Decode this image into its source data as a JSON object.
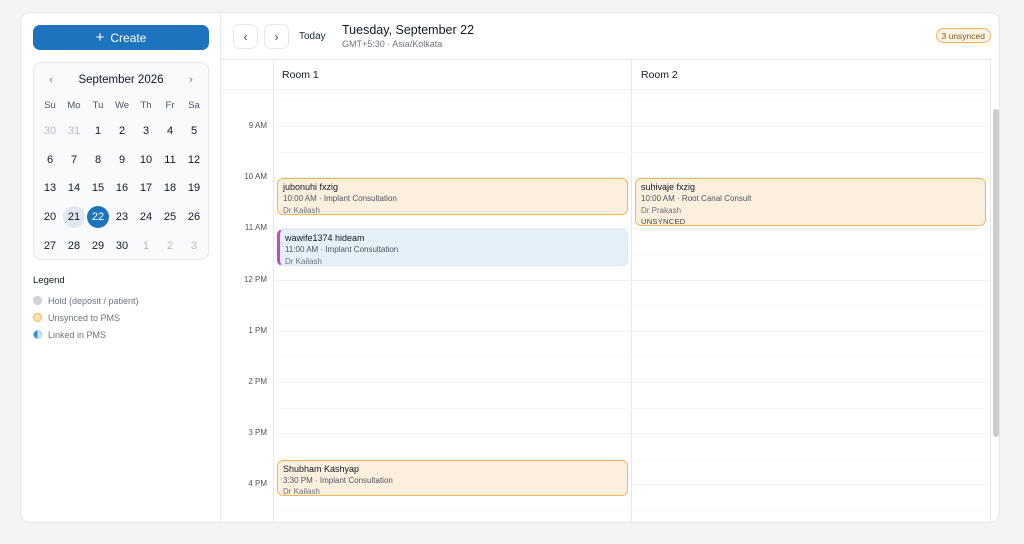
{
  "sidebar": {
    "create_label": "Create",
    "mini_calendar": {
      "month_label": "September 2026",
      "weekdays": [
        "Su",
        "Mo",
        "Tu",
        "We",
        "Th",
        "Fr",
        "Sa"
      ],
      "days": [
        {
          "label": "30",
          "muted": true
        },
        {
          "label": "31",
          "muted": true
        },
        {
          "label": "1"
        },
        {
          "label": "2"
        },
        {
          "label": "3"
        },
        {
          "label": "4"
        },
        {
          "label": "5"
        },
        {
          "label": "6"
        },
        {
          "label": "7"
        },
        {
          "label": "8"
        },
        {
          "label": "9"
        },
        {
          "label": "10"
        },
        {
          "label": "11"
        },
        {
          "label": "12"
        },
        {
          "label": "13"
        },
        {
          "label": "14"
        },
        {
          "label": "15"
        },
        {
          "label": "16"
        },
        {
          "label": "17"
        },
        {
          "label": "18"
        },
        {
          "label": "19"
        },
        {
          "label": "20"
        },
        {
          "label": "21",
          "highlight": true
        },
        {
          "label": "22",
          "selected": true
        },
        {
          "label": "23"
        },
        {
          "label": "24"
        },
        {
          "label": "25"
        },
        {
          "label": "26"
        },
        {
          "label": "27"
        },
        {
          "label": "28"
        },
        {
          "label": "29"
        },
        {
          "label": "30"
        },
        {
          "label": "1",
          "muted": true
        },
        {
          "label": "2",
          "muted": true
        },
        {
          "label": "3",
          "muted": true
        }
      ]
    },
    "legend": {
      "title": "Legend",
      "items": [
        {
          "label": "Hold (deposit / patient)",
          "kind": "hold",
          "color": "#d1d5db"
        },
        {
          "label": "Unsynced to PMS",
          "kind": "unsynced",
          "color": "#fde3b3"
        },
        {
          "label": "Linked in PMS",
          "kind": "linked",
          "color": "#2b8fd6"
        }
      ]
    }
  },
  "toolbar": {
    "prev_icon": "chevron-left-icon",
    "next_icon": "chevron-right-icon",
    "today_label": "Today",
    "date_title": "Tuesday, September 22",
    "timezone": "GMT+5:30 · Asia/Kolkata",
    "unsynced_badge": "3 unsynced"
  },
  "schedule": {
    "rooms": [
      "Room 1",
      "Room 2"
    ],
    "time_labels": [
      "9 AM",
      "10 AM",
      "11 AM",
      "12 PM",
      "1 PM",
      "2 PM",
      "3 PM",
      "4 PM"
    ],
    "events": [
      {
        "room": 0,
        "start_hour": 10.0,
        "end_hour": 10.75,
        "title": "jubonuhi fxzig",
        "time_label": "10:00 AM",
        "service": "Implant Consultation",
        "doctor": "Dr Kailash",
        "status": "unsynced",
        "tag": ""
      },
      {
        "room": 1,
        "start_hour": 10.0,
        "end_hour": 10.98,
        "title": "suhivaje fxzig",
        "time_label": "10:00 AM",
        "service": "Root Canal Consult",
        "doctor": "Dr Prakash",
        "status": "unsynced",
        "tag": "UNSYNCED"
      },
      {
        "room": 0,
        "start_hour": 11.0,
        "end_hour": 11.75,
        "title": "wawife1374 hideam",
        "time_label": "11:00 AM",
        "service": "Implant Consultation",
        "doctor": "Dr Kailash",
        "status": "linked",
        "tag": ""
      },
      {
        "room": 0,
        "start_hour": 15.5,
        "end_hour": 16.25,
        "title": "Shubham Kashyap",
        "time_label": "3:30 PM",
        "service": "Implant Consultation",
        "doctor": "Dr Kailash",
        "status": "unsynced",
        "tag": ""
      }
    ]
  },
  "colors": {
    "accent": "#1e73be",
    "unsynced_border": "#efb55c",
    "linked_border": "#c04ac9"
  }
}
